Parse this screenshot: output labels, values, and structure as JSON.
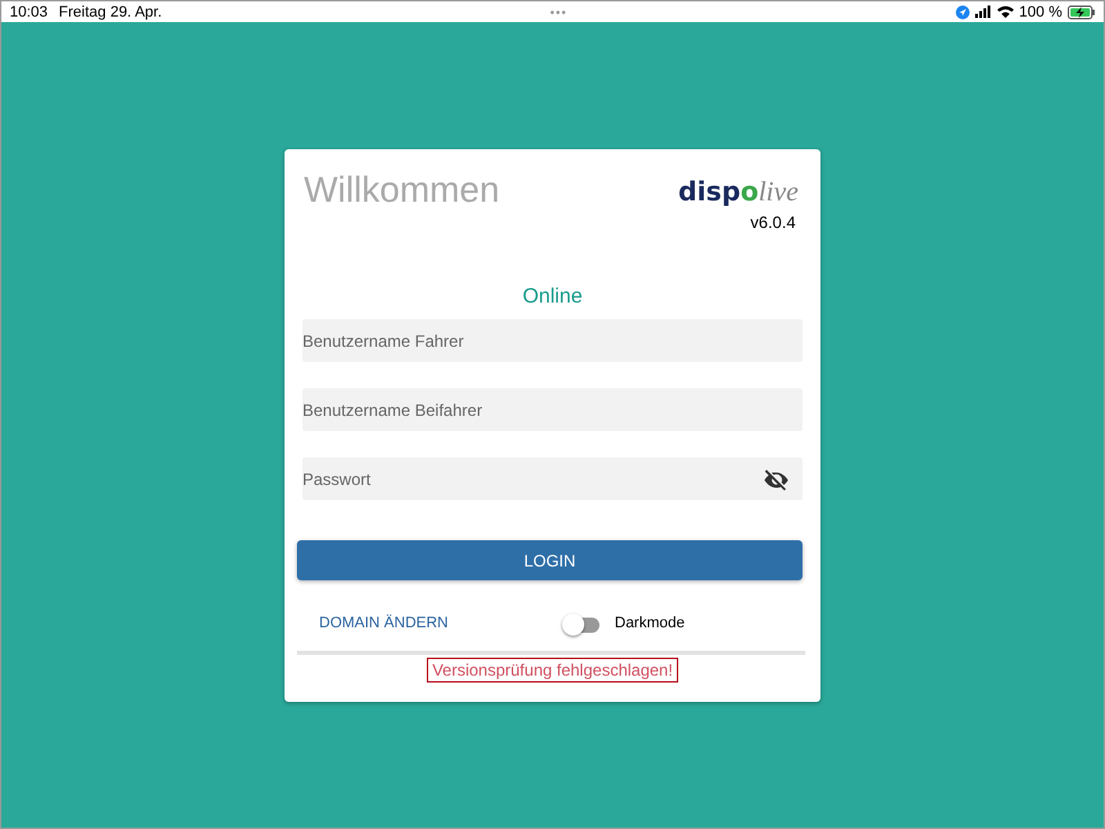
{
  "status_bar": {
    "time": "10:03",
    "date": "Freitag 29. Apr.",
    "dots": "•••",
    "battery": "100 %"
  },
  "card": {
    "title": "Willkommen",
    "logo": {
      "main": "dispo",
      "accent": "live"
    },
    "version": "v6.0.4",
    "connection": "Online",
    "fields": [
      {
        "placeholder": "Benutzername Fahrer",
        "kind": "text"
      },
      {
        "placeholder": "Benutzername Beifahrer",
        "kind": "text"
      },
      {
        "placeholder": "Passwort",
        "kind": "password"
      }
    ],
    "login_button": "LOGIN",
    "domain_link": "DOMAIN ÄNDERN",
    "darkmode": {
      "label": "Darkmode",
      "on": false
    },
    "error": "Versionsprüfung fehlgeschlagen!"
  }
}
